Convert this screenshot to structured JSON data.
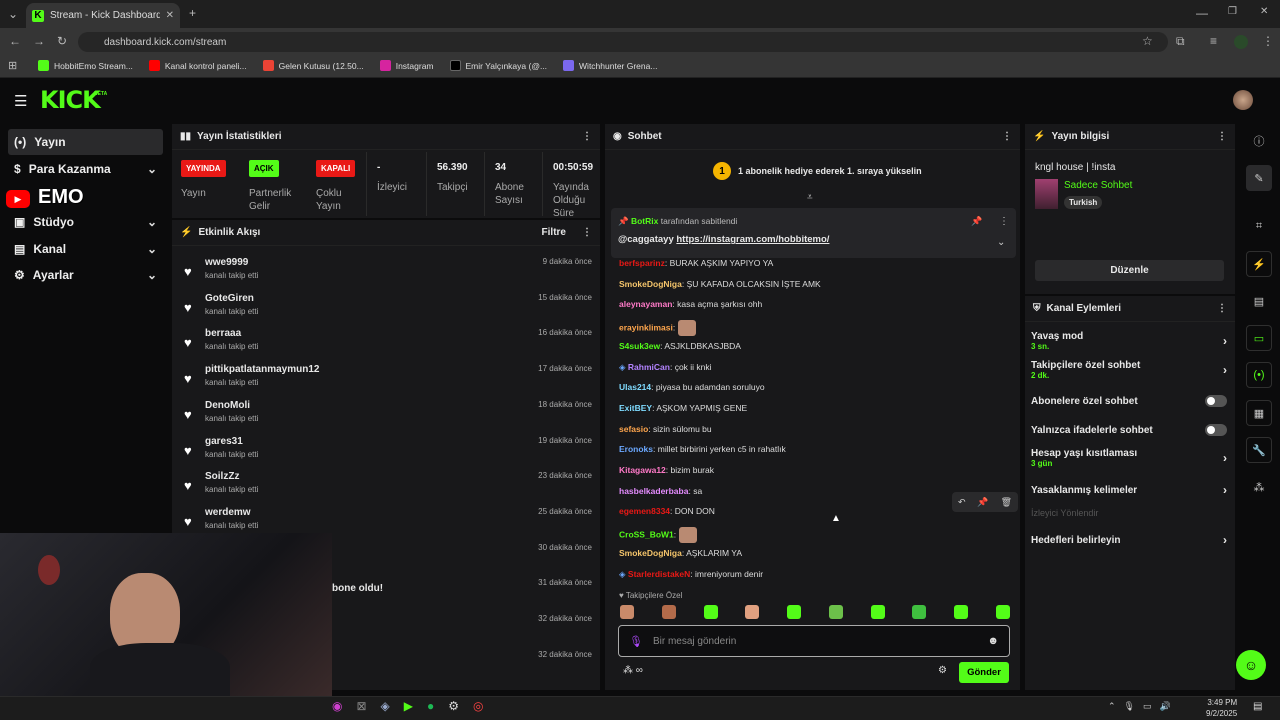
{
  "browser": {
    "tab_title": "Stream - Kick Dashboard",
    "url": "dashboard.kick.com/stream",
    "bookmarks": [
      {
        "label": "HobbitEmo Stream...",
        "color": "#53fc18"
      },
      {
        "label": "Kanal kontrol paneli...",
        "color": "#ff0000"
      },
      {
        "label": "Gelen Kutusu (12.50...",
        "color": "#ea4335"
      },
      {
        "label": "Instagram",
        "color": "#d6249f"
      },
      {
        "label": "Emir Yalçınkaya (@...",
        "color": "#000000"
      },
      {
        "label": "Witchhunter Grena...",
        "color": "#7b68ee"
      }
    ]
  },
  "logo": "KICK",
  "logo_beta": "BETA",
  "nav": [
    {
      "label": "Yayın",
      "icon": "broadcast-icon"
    },
    {
      "label": "Para Kazanma",
      "icon": "dollar-icon"
    },
    {
      "label": "Stüdyo",
      "icon": "studio-icon"
    },
    {
      "label": "Kanal",
      "icon": "channel-icon"
    },
    {
      "label": "Ayarlar",
      "icon": "gear-icon"
    }
  ],
  "overlay_text": "EMO",
  "stats": {
    "title": "Yayın İstatistikleri",
    "items": [
      {
        "badge": "YAYINDA",
        "badge_color": "#e91916",
        "label": "Yayın"
      },
      {
        "badge": "AÇIK",
        "badge_color": "#53fc18",
        "label": "Partnerlik Gelir"
      },
      {
        "badge": "KAPALI",
        "badge_color": "#e91916",
        "label": "Çoklu Yayın"
      },
      {
        "value": "-",
        "label": "İzleyici"
      },
      {
        "value": "56.390",
        "label": "Takipçi"
      },
      {
        "value": "34",
        "label": "Abone Sayısı"
      },
      {
        "value": "00:50:59",
        "label": "Yayında Olduğu Süre"
      }
    ]
  },
  "activity": {
    "title": "Etkinlik Akışı",
    "filter": "Filtre",
    "items": [
      {
        "name": "wwe9999",
        "sub": "kanalı takip etti",
        "time": "9 dakika önce"
      },
      {
        "name": "GoteGiren",
        "sub": "kanalı takip etti",
        "time": "15 dakika önce"
      },
      {
        "name": "berraaa",
        "sub": "kanalı takip etti",
        "time": "16 dakika önce"
      },
      {
        "name": "pittikpatlatanmaymun12",
        "sub": "kanalı takip etti",
        "time": "17 dakika önce"
      },
      {
        "name": "DenoMoli",
        "sub": "kanalı takip etti",
        "time": "18 dakika önce"
      },
      {
        "name": "gares31",
        "sub": "kanalı takip etti",
        "time": "19 dakika önce"
      },
      {
        "name": "SoilzZz",
        "sub": "kanalı takip etti",
        "time": "23 dakika önce"
      },
      {
        "name": "werdemw",
        "sub": "kanalı takip etti",
        "time": "25 dakika önce"
      },
      {
        "name": "",
        "sub": "",
        "time": "30 dakika önce"
      },
      {
        "name": "bone oldu!",
        "sub": "",
        "time": "31 dakika önce"
      },
      {
        "name": "",
        "sub": "",
        "time": "32 dakika önce"
      },
      {
        "name": "",
        "sub": "",
        "time": "32 dakika önce"
      }
    ]
  },
  "chat": {
    "title": "Sohbet",
    "goal": "1 abonelik hediye ederek 1. sıraya yükselin",
    "goal_num": "1",
    "pinned_by": "BotRix",
    "pinned_suffix": "tarafından sabitlendi",
    "pinned_text": "@caggatayy",
    "pinned_link": "https://instagram.com/hobbitemo/",
    "messages": [
      {
        "user": "berfsparinz",
        "color": "#e91916",
        "text": "BURAK AŞKIM YAPIYO YA"
      },
      {
        "user": "SmokeDogNiga",
        "color": "#f5c56b",
        "text": "ŞU KAFADA OLCAKSIN İŞTE AMK"
      },
      {
        "user": "aleynayaman",
        "color": "#ff7ac8",
        "text": "kasa açma şarkısı ohh"
      },
      {
        "user": "erayinklimasi",
        "color": "#ffa64d",
        "text": ""
      },
      {
        "user": "S4suk3ew",
        "color": "#53fc18",
        "text": "ASJKLDBKASJBDA"
      },
      {
        "user": "RahmiCan",
        "color": "#b383ff",
        "text": "çok ii knki"
      },
      {
        "user": "Ulas214",
        "color": "#7fdbff",
        "text": "piyasa bu adamdan soruluyo"
      },
      {
        "user": "ExitBEY",
        "color": "#7fdbff",
        "text": "AŞKOM YAPMIŞ GENE"
      },
      {
        "user": "sefasio",
        "color": "#ffa64d",
        "text": "sizin sülomu bu"
      },
      {
        "user": "Eronoks",
        "color": "#6ba8ff",
        "text": "millet birbirini yerken c5 in rahatlık"
      },
      {
        "user": "Kitagawa12",
        "color": "#ff7ac8",
        "text": "bizim burak"
      },
      {
        "user": "hasbelkaderbaba",
        "color": "#e58cff",
        "text": "sa"
      },
      {
        "user": "egemen8334",
        "color": "#e91916",
        "text": "DON DON"
      },
      {
        "user": "CroSS_BoW1",
        "color": "#53fc18",
        "text": ""
      },
      {
        "user": "SmokeDogNiga",
        "color": "#f5c56b",
        "text": "AŞKLARIM YA"
      },
      {
        "user": "StarlerdistakeN",
        "color": "#e91916",
        "text": "imreniyorum denir"
      }
    ],
    "followers_only_label": "Takipçilere Özel",
    "input_placeholder": "Bir mesaj gönderin",
    "send": "Gönder"
  },
  "stream_info": {
    "title": "Yayın bilgisi",
    "stream_title": "kngl house | !insta",
    "category": "Sadece Sohbet",
    "language": "Turkish",
    "edit": "Düzenle"
  },
  "channel_actions": {
    "title": "Kanal Eylemleri",
    "items": [
      {
        "label": "Yavaş mod",
        "sub": "3 sn.",
        "kind": "chevron"
      },
      {
        "label": "Takipçilere özel sohbet",
        "sub": "2 dk.",
        "kind": "chevron"
      },
      {
        "label": "Abonelere özel sohbet",
        "sub": "",
        "kind": "toggle"
      },
      {
        "label": "Yalnızca ifadelerle sohbet",
        "sub": "",
        "kind": "toggle"
      },
      {
        "label": "Hesap yaşı kısıtlaması",
        "sub": "3 gün",
        "kind": "chevron"
      },
      {
        "label": "Yasaklanmış kelimeler",
        "sub": "",
        "kind": "chevron"
      },
      {
        "label": "İzleyici Yönlendir",
        "sub": "",
        "kind": "disabled"
      },
      {
        "label": "Hedefleri belirleyin",
        "sub": "",
        "kind": "chevron"
      }
    ]
  },
  "taskbar": {
    "time": "3:49 PM",
    "date": "9/2/2025"
  }
}
